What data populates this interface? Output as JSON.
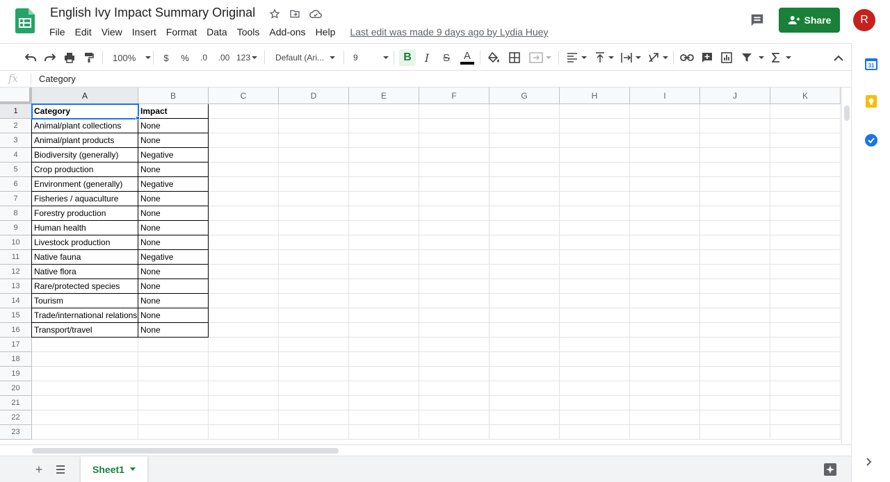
{
  "doc": {
    "title": "English Ivy Impact Summary Original",
    "last_edit": "Last edit was made 9 days ago by Lydia Huey"
  },
  "menu": [
    "File",
    "Edit",
    "View",
    "Insert",
    "Format",
    "Data",
    "Tools",
    "Add-ons",
    "Help"
  ],
  "header": {
    "share_label": "Share",
    "avatar_initial": "R"
  },
  "toolbar": {
    "zoom": "100%",
    "currency": "$",
    "percent": "%",
    "decrease_decimal": ".0",
    "increase_decimal": ".00",
    "more_formats": "123",
    "font": "Default (Ari...",
    "font_size": "9",
    "bold": "B",
    "italic": "I",
    "strike": "S",
    "text_color": "A"
  },
  "formula_bar": {
    "fx": "fx",
    "content": "Category"
  },
  "columns": [
    "A",
    "B",
    "C",
    "D",
    "E",
    "F",
    "G",
    "H",
    "I",
    "J",
    "K"
  ],
  "rows": [
    "1",
    "2",
    "3",
    "4",
    "5",
    "6",
    "7",
    "8",
    "9",
    "10",
    "11",
    "12",
    "13",
    "14",
    "15",
    "16",
    "17",
    "18",
    "19",
    "20",
    "21",
    "22",
    "23"
  ],
  "table": [
    [
      "Category",
      "Impact"
    ],
    [
      "Animal/plant collections",
      "None"
    ],
    [
      "Animal/plant products",
      "None"
    ],
    [
      "Biodiversity (generally)",
      "Negative"
    ],
    [
      "Crop production",
      "None"
    ],
    [
      "Environment (generally)",
      "Negative"
    ],
    [
      "Fisheries / aquaculture",
      "None"
    ],
    [
      "Forestry production",
      "None"
    ],
    [
      "Human health",
      "None"
    ],
    [
      "Livestock production",
      "None"
    ],
    [
      "Native fauna",
      "Negative"
    ],
    [
      "Native flora",
      "None"
    ],
    [
      "Rare/protected species",
      "None"
    ],
    [
      "Tourism",
      "None"
    ],
    [
      "Trade/international relations",
      "None"
    ],
    [
      "Transport/travel",
      "None"
    ]
  ],
  "selected_cell": "A1",
  "sheets": [
    {
      "label": "Sheet1",
      "active": true
    }
  ],
  "colors": {
    "brand_green": "#188038",
    "selection_blue": "#1a73e8",
    "avatar": "#c5221f"
  }
}
